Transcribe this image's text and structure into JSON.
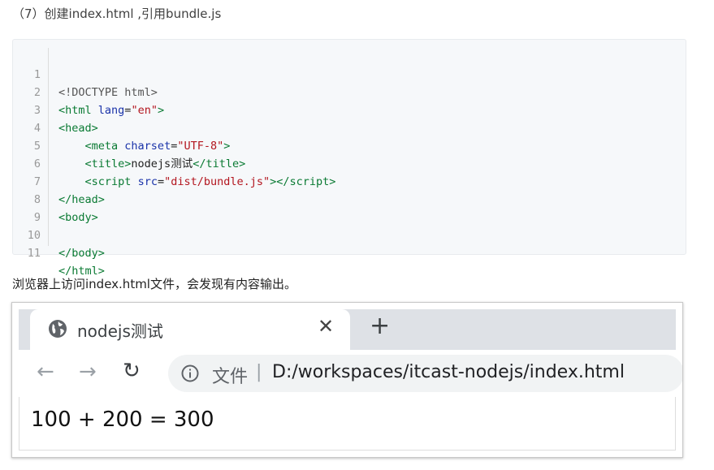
{
  "heading": "（7）创建index.html ,引用bundle.js",
  "code": {
    "line_numbers": [
      "1",
      "2",
      "3",
      "4",
      "5",
      "6",
      "7",
      "8",
      "9",
      "10",
      "11"
    ]
  },
  "paragraph": "浏览器上访问index.html文件，会发现有内容输出。",
  "browser": {
    "tab_title": "nodejs测试",
    "tab_close": "✕",
    "new_tab": "+",
    "back": "←",
    "forward": "→",
    "reload": "↻",
    "scheme_label": "文件",
    "separator": "|",
    "url": "D:/workspaces/itcast-nodejs/index.html",
    "output_text": "100 + 200 = 300"
  }
}
